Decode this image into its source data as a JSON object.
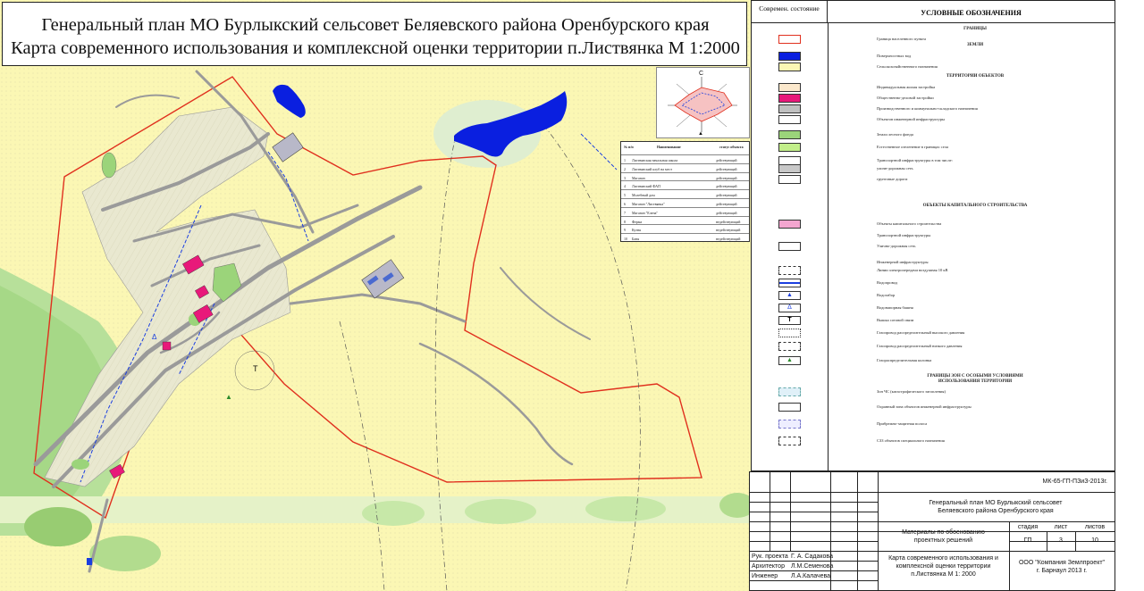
{
  "title": {
    "line1": "Генеральный план МО Бурлыкский сельсовет Беляевского района Оренбурского края",
    "line2": "Карта современного использования и комплексной оценки территории п.Листвянка М 1:2000"
  },
  "windrose": {
    "north": "С"
  },
  "objects_table": {
    "headers": [
      "№ п/п",
      "Наименование",
      "статус объекта"
    ],
    "rows": [
      [
        "1",
        "Листвянская начальная школа",
        "действующий"
      ],
      [
        "2",
        "Листвянский клуб на  мест",
        "действующий"
      ],
      [
        "3",
        "Магазин",
        "действующий"
      ],
      [
        "4",
        "Листвянский ФАП",
        "действующий"
      ],
      [
        "5",
        "Молебный дом",
        "действующий"
      ],
      [
        "6",
        "Магазин \"Листвянка\"",
        "действующий"
      ],
      [
        "7",
        "Магазин \"Елена\"",
        "действующий"
      ],
      [
        "8",
        "Ферма",
        "недействующий"
      ],
      [
        "9",
        "Кузня",
        "недействующий"
      ],
      [
        "10",
        "Баня",
        "недействующий"
      ]
    ]
  },
  "legend": {
    "head_state": "Совремeн. состояние",
    "head_title": "УСЛОВНЫЕ ОБОЗНАЧЕНИЯ",
    "sections": {
      "borders": "ГРАНИЦЫ",
      "lands": "ЗЕМЛИ",
      "object_territories": "ТЕРРИТОРИИ ОБЪЕКТОВ",
      "capital_objects": "ОБЪЕКТЫ КАПИТАЛЬНОГО СТРОИТЕЛЬСТВА",
      "special_zones_1": "ГРАНИЦЫ ЗОН С ОСОБЫМИ УСЛОВИЯМИ",
      "special_zones_2": "ИСПОЛЬЗОВАНИЯ ТЕРРИТОРИИ"
    },
    "items": {
      "settlement_border": "Граница населенного пункта",
      "surface_water": "Поверхностных вод",
      "agricultural": "Сельскохозяйственного назначения",
      "individual_housing": "Индивидуальная жилая застройка",
      "public_business": "Общественно-деловой застройки",
      "industrial": "Производственного и коммунально-складского назначения",
      "engineering": "Объектов инженерной инфраструктуры",
      "forest_fund": "Земли лесного фонда",
      "natural_landscape": "Естественное озеленение в границах села",
      "transport": "Транспортной инфраструктуры в том числе:",
      "street_network": "уличн-дорожная сеть",
      "dirt_roads": "грунтовые дороги",
      "capital_construction": "Объекты капитального строительства",
      "transport_infra": "Транспортной инфраструктуры",
      "street_road_net": "Улично-дорожная сеть",
      "engineering_infra": "Инженерной инфраструктуры",
      "power_line": "Линии электропередачи воздушная 10 кВ",
      "water_pipe": "Водопровод",
      "water_intake": "Водозабор",
      "water_tower": "Водонапорная башня",
      "cell_tower": "Вышка сотовой связи",
      "gas_high": "Газопровод распределительный высокого давления",
      "gas_low": "Газопровод распределительный низкого давления",
      "gas_station": "Газораспределительная колонка",
      "emergency_zone": "Зон ЧС (катастрофического затопления)",
      "protection_zone": "Охранный зона объектов инженерной инфраструктуры",
      "coastal_strip": "Прибрежно-защитная полоса",
      "sanitary_zone": "СЗЗ объектов специального назначения"
    }
  },
  "stamp": {
    "doc_code": "МК-65-ГП-ПЗиЗ-2013г.",
    "plan_title_1": "Генеральный план МО Бурлыкский сельсовет",
    "plan_title_2": "Беляевского района Оренбурского края",
    "materials_1": "Материалы по обоснованию",
    "materials_2": "проектных решений",
    "col_stage": "стадия",
    "col_sheet": "лист",
    "col_sheets": "листов",
    "stage": "ГП",
    "sheet": "3",
    "sheets": "10",
    "map_title_1": "Карта современного использования и",
    "map_title_2": "комплексной оценки территории",
    "map_title_3": "п.Листвянка М 1: 2000",
    "company_1": "ООО \"Компания Землпроект\"",
    "company_2": "г. Барнаул 2013 г.",
    "roles": [
      {
        "role": "Рук. проекта",
        "name": "Г. А. Садакова"
      },
      {
        "role": "Архитектор",
        "name": "Л.М.Семенова"
      },
      {
        "role": "Инженер",
        "name": "Л.А.Калачева"
      }
    ]
  },
  "colors": {
    "agricultural": "#fbf7b4",
    "water": "#0a1fe0",
    "green": "#9bd47a",
    "public": "#e8197a",
    "housing": "#e9e8d0",
    "border": "#e0301e",
    "road": "#9a9a9a"
  }
}
